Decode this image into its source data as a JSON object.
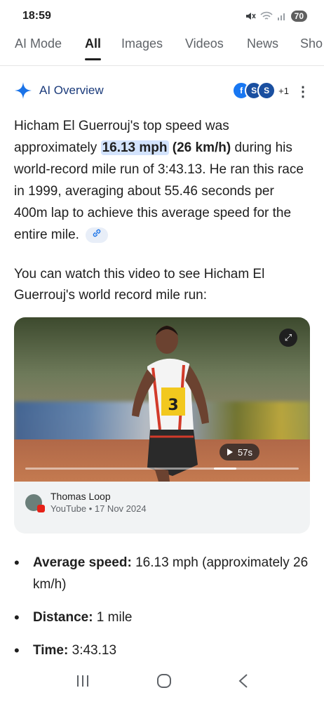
{
  "status_bar": {
    "time": "18:59",
    "battery": "70",
    "icons": [
      "mute-icon",
      "wifi-icon",
      "signal-icon"
    ]
  },
  "tabs": [
    {
      "label": "AI Mode",
      "active": false
    },
    {
      "label": "All",
      "active": true
    },
    {
      "label": "Images",
      "active": false
    },
    {
      "label": "Videos",
      "active": false
    },
    {
      "label": "News",
      "active": false
    },
    {
      "label": "Sho",
      "active": false
    }
  ],
  "ai_overview": {
    "title": "AI Overview",
    "sources_more": "+1",
    "answer_parts": {
      "a": "Hicham El Guerrouj's top speed was approximately ",
      "mph": "16.13 mph",
      "kmh": "(26 km/h)",
      "b": " during his world-record mile run of 3:43.13. He ran this race in 1999, averaging about 55.46 seconds per 400m lap to achieve this average speed for the entire mile."
    },
    "video_intro": "You can watch this video to see Hicham El Guerrouj's world record mile run:",
    "video": {
      "duration": "57s",
      "progress": 0.73,
      "channel": "Thomas Loop",
      "source_line": "YouTube • 17 Nov 2024",
      "bib_number": "3"
    },
    "bullets": [
      {
        "label": "Average speed:",
        "text": " 16.13 mph (approximately 26 km/h)"
      },
      {
        "label": "Distance:",
        "text": " 1 mile"
      },
      {
        "label": "Time:",
        "text": " 3:43.13"
      }
    ]
  },
  "colors": {
    "accent_blue": "#1a73e8",
    "highlight": "#d3e3fd",
    "text": "#1f1f1f"
  }
}
